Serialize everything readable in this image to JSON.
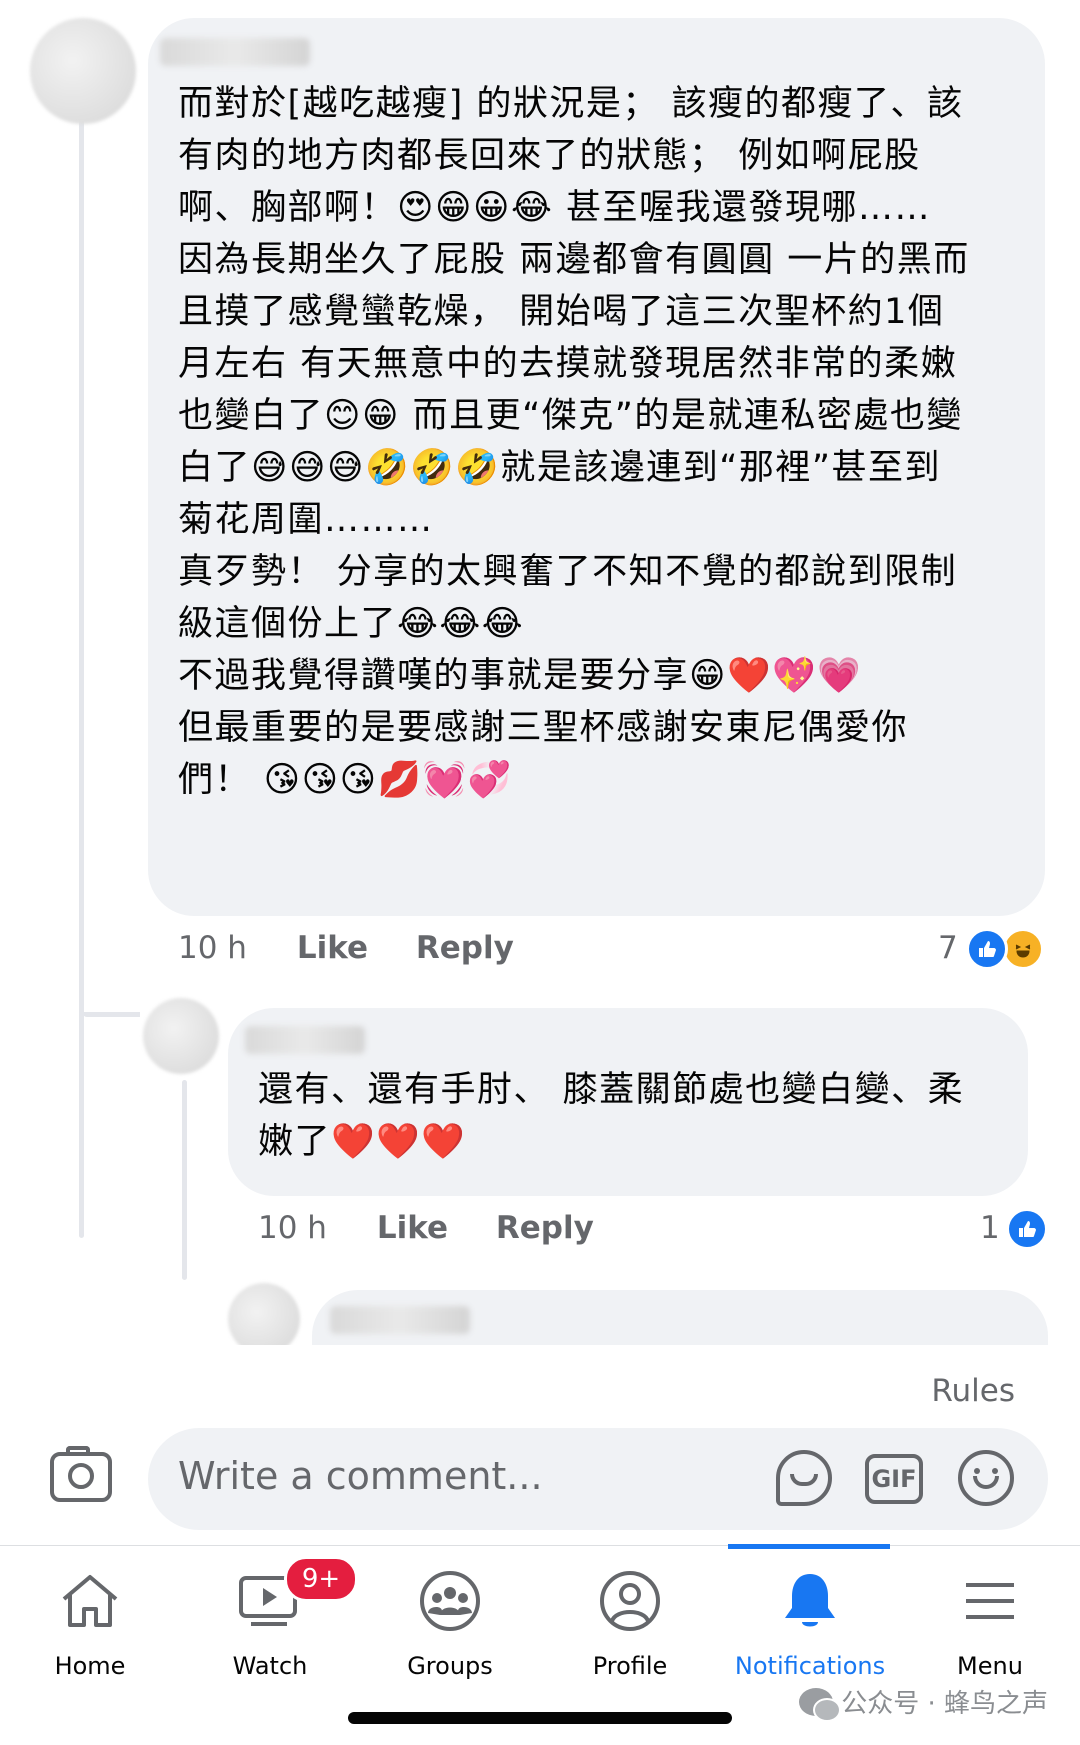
{
  "comments": [
    {
      "text": "而對於[越吃越瘦] 的狀況是； 該瘦的都瘦了、該\n有肉的地方肉都長回來了的狀態； 例如啊屁股\n啊、胸部啊！😍😁😀😂 甚至喔我還發現哪……\n因為長期坐久了屁股 兩邊都會有圓圓 一片的黑而\n且摸了感覺蠻乾燥， 開始喝了這三次聖杯約1個\n月左右 有天無意中的去摸就發現居然非常的柔嫩\n也變白了😊😁 而且更“傑克”的是就連私密處也變\n白了😅😅😅🤣🤣🤣就是該邊連到“那裡”甚至到\n菊花周圍………\n真歹勢！ 分享的太興奮了不知不覺的都說到限制\n級這個份上了😂😂😂\n不過我覺得讚嘆的事就是要分享😁❤️💖💗\n但最重要的是要感謝三聖杯感謝安東尼偶愛你\n們！ 😘😘😘💋💓💞",
      "time": "10 h",
      "like_label": "Like",
      "reply_label": "Reply",
      "reaction_count": "7",
      "reactions": [
        "like-icon",
        "haha-icon"
      ]
    },
    {
      "text": "還有、還有手肘、 膝蓋關節處也變白變、柔\n嫩了❤️❤️❤️",
      "time": "10 h",
      "like_label": "Like",
      "reply_label": "Reply",
      "reaction_count": "1",
      "reactions": [
        "like-icon"
      ]
    }
  ],
  "composer": {
    "rules_label": "Rules",
    "placeholder": "Write a comment...",
    "gif_label": "GIF"
  },
  "nav": {
    "items": [
      {
        "label": "Home",
        "icon": "home-icon",
        "active": false
      },
      {
        "label": "Watch",
        "icon": "watch-icon",
        "active": false,
        "badge": "9+"
      },
      {
        "label": "Groups",
        "icon": "groups-icon",
        "active": false
      },
      {
        "label": "Profile",
        "icon": "profile-icon",
        "active": false
      },
      {
        "label": "Notifications",
        "icon": "bell-icon",
        "active": true
      },
      {
        "label": "Menu",
        "icon": "menu-icon",
        "active": false
      }
    ]
  },
  "watermark": "公众号 · 蜂鸟之声",
  "colors": {
    "accent": "#1877f2",
    "bubble": "#f0f2f5",
    "secondary_text": "#65676b",
    "badge": "#e41e3f"
  }
}
